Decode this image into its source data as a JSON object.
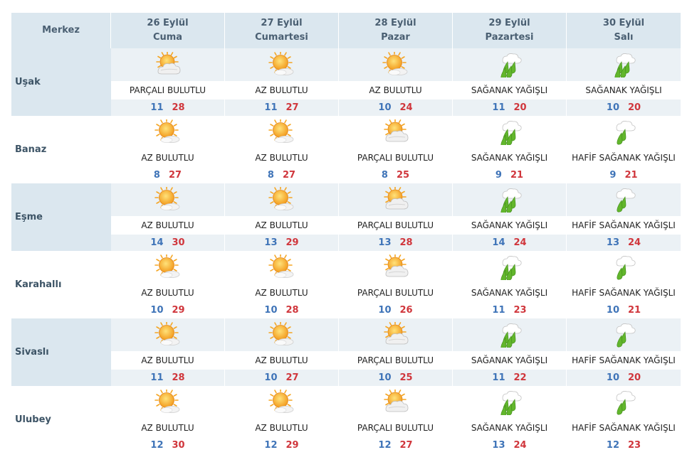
{
  "header": {
    "region_label": "Merkez",
    "days": [
      {
        "date": "26 Eylül",
        "weekday": "Cuma"
      },
      {
        "date": "27 Eylül",
        "weekday": "Cumartesi"
      },
      {
        "date": "28 Eylül",
        "weekday": "Pazar"
      },
      {
        "date": "29 Eylül",
        "weekday": "Pazartesi"
      },
      {
        "date": "30 Eylül",
        "weekday": "Salı"
      }
    ]
  },
  "rows": [
    {
      "name": "Uşak",
      "days": [
        {
          "icon": "partly-cloudy-icon",
          "condition": "PARÇALI BULUTLU",
          "low": "11",
          "high": "28"
        },
        {
          "icon": "sun-cloud-icon",
          "condition": "AZ BULUTLU",
          "low": "11",
          "high": "27"
        },
        {
          "icon": "sun-cloud-icon",
          "condition": "AZ BULUTLU",
          "low": "10",
          "high": "24"
        },
        {
          "icon": "heavy-rain-icon",
          "condition": "SAĞANAK YAĞIŞLI",
          "low": "11",
          "high": "20"
        },
        {
          "icon": "heavy-rain-icon",
          "condition": "SAĞANAK YAĞIŞLI",
          "low": "10",
          "high": "20"
        }
      ]
    },
    {
      "name": "Banaz",
      "days": [
        {
          "icon": "sun-cloud-icon",
          "condition": "AZ BULUTLU",
          "low": "8",
          "high": "27"
        },
        {
          "icon": "sun-cloud-icon",
          "condition": "AZ BULUTLU",
          "low": "8",
          "high": "27"
        },
        {
          "icon": "partly-cloudy-icon",
          "condition": "PARÇALI BULUTLU",
          "low": "8",
          "high": "25"
        },
        {
          "icon": "heavy-rain-icon",
          "condition": "SAĞANAK YAĞIŞLI",
          "low": "9",
          "high": "21"
        },
        {
          "icon": "light-rain-icon",
          "condition": "HAFİF SAĞANAK YAĞIŞLI",
          "low": "9",
          "high": "21"
        }
      ]
    },
    {
      "name": "Eşme",
      "days": [
        {
          "icon": "sun-cloud-icon",
          "condition": "AZ BULUTLU",
          "low": "14",
          "high": "30"
        },
        {
          "icon": "sun-cloud-icon",
          "condition": "AZ BULUTLU",
          "low": "13",
          "high": "29"
        },
        {
          "icon": "partly-cloudy-icon",
          "condition": "PARÇALI BULUTLU",
          "low": "13",
          "high": "28"
        },
        {
          "icon": "heavy-rain-icon",
          "condition": "SAĞANAK YAĞIŞLI",
          "low": "14",
          "high": "24"
        },
        {
          "icon": "light-rain-icon",
          "condition": "HAFİF SAĞANAK YAĞIŞLI",
          "low": "13",
          "high": "24"
        }
      ]
    },
    {
      "name": "Karahallı",
      "days": [
        {
          "icon": "sun-cloud-icon",
          "condition": "AZ BULUTLU",
          "low": "10",
          "high": "29"
        },
        {
          "icon": "sun-cloud-icon",
          "condition": "AZ BULUTLU",
          "low": "10",
          "high": "28"
        },
        {
          "icon": "partly-cloudy-icon",
          "condition": "PARÇALI BULUTLU",
          "low": "10",
          "high": "26"
        },
        {
          "icon": "heavy-rain-icon",
          "condition": "SAĞANAK YAĞIŞLI",
          "low": "11",
          "high": "23"
        },
        {
          "icon": "light-rain-icon",
          "condition": "HAFİF SAĞANAK YAĞIŞLI",
          "low": "10",
          "high": "21"
        }
      ]
    },
    {
      "name": "Sivaslı",
      "days": [
        {
          "icon": "sun-cloud-icon",
          "condition": "AZ BULUTLU",
          "low": "11",
          "high": "28"
        },
        {
          "icon": "sun-cloud-icon",
          "condition": "AZ BULUTLU",
          "low": "10",
          "high": "27"
        },
        {
          "icon": "partly-cloudy-icon",
          "condition": "PARÇALI BULUTLU",
          "low": "10",
          "high": "25"
        },
        {
          "icon": "heavy-rain-icon",
          "condition": "SAĞANAK YAĞIŞLI",
          "low": "11",
          "high": "22"
        },
        {
          "icon": "light-rain-icon",
          "condition": "HAFİF SAĞANAK YAĞIŞLI",
          "low": "10",
          "high": "20"
        }
      ]
    },
    {
      "name": "Ulubey",
      "days": [
        {
          "icon": "sun-cloud-icon",
          "condition": "AZ BULUTLU",
          "low": "12",
          "high": "30"
        },
        {
          "icon": "sun-cloud-icon",
          "condition": "AZ BULUTLU",
          "low": "12",
          "high": "29"
        },
        {
          "icon": "partly-cloudy-icon",
          "condition": "PARÇALI BULUTLU",
          "low": "12",
          "high": "27"
        },
        {
          "icon": "heavy-rain-icon",
          "condition": "SAĞANAK YAĞIŞLI",
          "low": "13",
          "high": "24"
        },
        {
          "icon": "light-rain-icon",
          "condition": "HAFİF SAĞANAK YAĞIŞLI",
          "low": "12",
          "high": "23"
        }
      ]
    }
  ],
  "colors": {
    "header_bg": "#dbe7ef",
    "shade_bg": "#ebf1f5",
    "low_temp": "#3f74b8",
    "high_temp": "#d0363c"
  }
}
